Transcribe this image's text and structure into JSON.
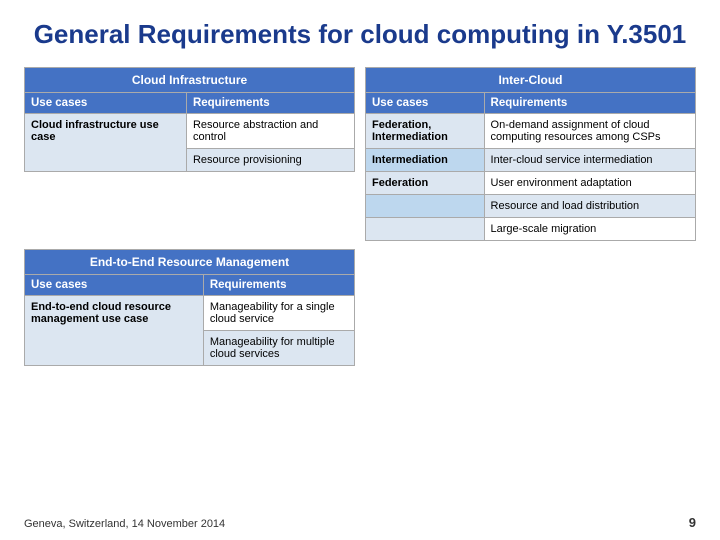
{
  "title": "General Requirements for cloud computing in Y.3501",
  "cloud_infra": {
    "section_header": "Cloud Infrastructure",
    "col_use_cases": "Use cases",
    "col_requirements": "Requirements",
    "rows": [
      {
        "use_case": "Cloud infrastructure use case",
        "requirements": [
          "Resource abstraction and control",
          "Resource provisioning"
        ]
      }
    ]
  },
  "inter_cloud": {
    "section_header": "Inter-Cloud",
    "col_use_cases": "Use cases",
    "col_requirements": "Requirements",
    "rows": [
      {
        "use_case": "Federation, Intermediation",
        "requirement": "On-demand assignment of cloud computing resources among CSPs"
      },
      {
        "use_case": "Intermediation",
        "requirement": "Inter-cloud service intermediation"
      },
      {
        "use_case": "Federation",
        "requirement": "User environment adaptation"
      },
      {
        "use_case": "",
        "requirement": "Resource and load distribution"
      },
      {
        "use_case": "",
        "requirement": "Large-scale migration"
      }
    ]
  },
  "end_to_end": {
    "section_header": "End-to-End Resource Management",
    "col_use_cases": "Use cases",
    "col_requirements": "Requirements",
    "rows": [
      {
        "use_case": "End-to-end cloud resource management use case",
        "requirements": [
          "Manageability for a single cloud service",
          "Manageability for multiple cloud services"
        ]
      }
    ]
  },
  "footer": {
    "location": "Geneva, Switzerland, 14 November 2014",
    "page_number": "9"
  }
}
